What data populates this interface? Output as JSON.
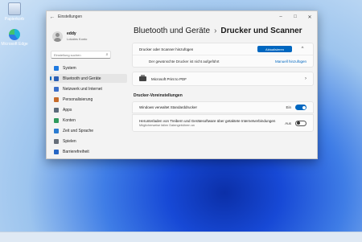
{
  "desktop": {
    "icons": [
      {
        "label": "Papierkorb",
        "icon": "recycle-bin-icon"
      },
      {
        "label": "Microsoft Edge",
        "icon": "edge-icon"
      }
    ]
  },
  "window": {
    "title": "Einstellungen",
    "controls": {
      "minimize": "–",
      "maximize": "□",
      "close": "✕"
    },
    "back_glyph": "←"
  },
  "profile": {
    "name": "eddy",
    "account": "Lokales Konto"
  },
  "search": {
    "placeholder": "Einstellung suchen",
    "icon": "search-icon"
  },
  "sidebar": {
    "items": [
      {
        "label": "System",
        "icon": "system-icon",
        "color": "#1f7ae0",
        "active": false
      },
      {
        "label": "Bluetooth und Geräte",
        "icon": "bluetooth-icon",
        "color": "#2a5fb5",
        "active": true
      },
      {
        "label": "Netzwerk und Internet",
        "icon": "network-icon",
        "color": "#3b6fc9",
        "active": false
      },
      {
        "label": "Personalisierung",
        "icon": "personalization-icon",
        "color": "#c66b2a",
        "active": false
      },
      {
        "label": "Apps",
        "icon": "apps-icon",
        "color": "#5b6a7a",
        "active": false
      },
      {
        "label": "Konten",
        "icon": "accounts-icon",
        "color": "#2e9a5c",
        "active": false
      },
      {
        "label": "Zeit und Sprache",
        "icon": "time-language-icon",
        "color": "#2a7bd0",
        "active": false
      },
      {
        "label": "Spielen",
        "icon": "gaming-icon",
        "color": "#666e78",
        "active": false
      },
      {
        "label": "Barrierefreiheit",
        "icon": "accessibility-icon",
        "color": "#2766c4",
        "active": false
      }
    ]
  },
  "breadcrumb": {
    "parent": "Bluetooth und Geräte",
    "separator": "›",
    "current": "Drucker und Scanner"
  },
  "add_device": {
    "label": "Drucker oder Scanner hinzufügen",
    "button": "Aktualisieren",
    "chevron": "^",
    "missing_text": "Der gewünschte Drucker ist nicht aufgeführt",
    "manual_link": "Manuell hinzufügen"
  },
  "printers": [
    {
      "name": "Microsoft Print to PDF",
      "icon": "printer-icon",
      "arrow": "›"
    }
  ],
  "preferences": {
    "heading": "Drucker-Voreinstellungen",
    "settings": [
      {
        "label": "Windows verwaltet Standarddrucker",
        "description": "",
        "state": "Ein",
        "on": true
      },
      {
        "label": "Herunterladen von Treibern und Gerätesoftware über getaktete Internetverbindungen",
        "description": "Möglicherweise fallen Datengebühren an",
        "state": "Aus",
        "on": false
      }
    ]
  },
  "colors": {
    "accent": "#0067c0",
    "window_bg": "#f3f3f3",
    "card_bg": "#fbfbfb"
  }
}
